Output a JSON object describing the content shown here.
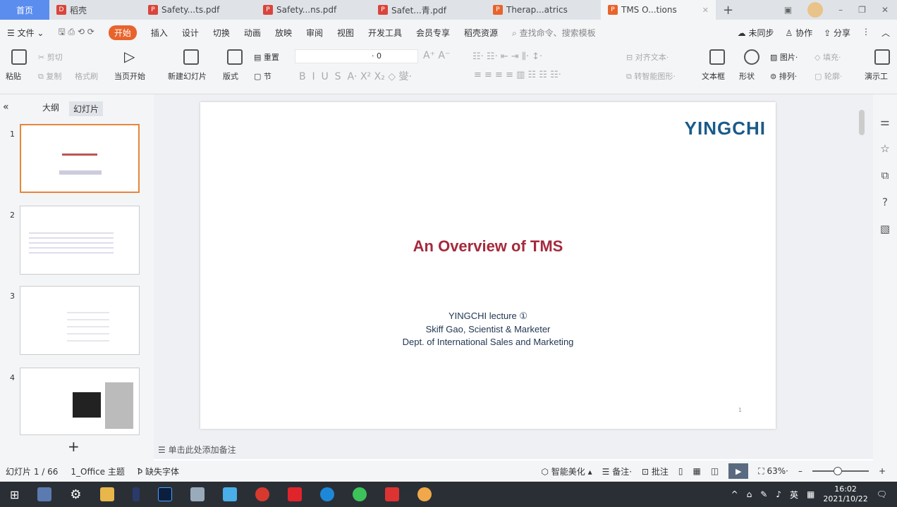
{
  "tabs": [
    {
      "label": "首页"
    },
    {
      "label": "稻壳"
    },
    {
      "label": "Safety...ts.pdf"
    },
    {
      "label": "Safety...ns.pdf"
    },
    {
      "label": "Safet...青.pdf"
    },
    {
      "label": "Therap...atrics"
    },
    {
      "label": "TMS O...tions"
    }
  ],
  "menu": {
    "file": "文件",
    "items": [
      "开始",
      "插入",
      "设计",
      "切换",
      "动画",
      "放映",
      "审阅",
      "视图",
      "开发工具",
      "会员专享",
      "稻壳资源"
    ],
    "search_placeholder": "查找命令、搜索模板",
    "sync": "未同步",
    "collab": "协作",
    "share": "分享"
  },
  "ribbon": {
    "paste": "粘贴",
    "cut": "剪切",
    "copy": "复制",
    "format_painter": "格式刷",
    "play_from": "当页开始",
    "new_slide": "新建幻灯片",
    "layout": "版式",
    "section": "节",
    "reset": "重置",
    "font_size": "0",
    "align_text": "对齐文本",
    "smartart": "转智能图形",
    "textbox": "文本框",
    "shape": "形状",
    "picture": "图片",
    "fill": "填充",
    "arrange": "排列",
    "outline": "轮廓",
    "present": "演示工"
  },
  "pane": {
    "outline_tab": "大纲",
    "slides_tab": "幻灯片",
    "slides": [
      "1",
      "2",
      "3",
      "4"
    ]
  },
  "slide": {
    "logo": "YINGCHI",
    "title": "An Overview of TMS",
    "lines": [
      "YINGCHI lecture ①",
      "Skiff Gao, Scientist & Marketer",
      "Dept. of International Sales and Marketing"
    ],
    "page": "1"
  },
  "notes_placeholder": "单击此处添加备注",
  "status": {
    "slide_count": "幻灯片 1 / 66",
    "theme": "1_Office 主题",
    "missing_font": "缺失字体",
    "beautify": "智能美化",
    "notes": "备注",
    "comments": "批注",
    "zoom": "63%",
    "zoom_fraction": 0.45
  },
  "taskbar": {
    "ime": "英",
    "time": "16:02",
    "date": "2021/10/22"
  }
}
